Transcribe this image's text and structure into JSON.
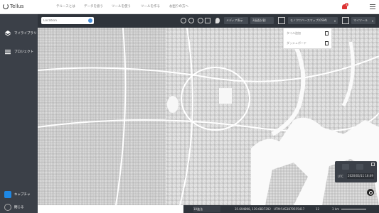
{
  "app": {
    "name": "Tellus"
  },
  "nav": [
    {
      "label": "テルースとは"
    },
    {
      "label": "データを扱う"
    },
    {
      "label": "ツールを使う"
    },
    {
      "label": "ツールを作る"
    },
    {
      "label": "お困りの方へ"
    }
  ],
  "notifications": {
    "count": "3"
  },
  "sidebar": {
    "items": [
      {
        "label": "マイライブラリ"
      },
      {
        "label": "プロジェクト"
      }
    ],
    "capture_label": "キャプチャ",
    "close_label": "閉じる"
  },
  "search": {
    "placeholder": "Location"
  },
  "toolbar": {
    "media_button": "メディア表示",
    "split_button": "2画面分割",
    "basemap_select": "モノクロベースマップ(OSM)",
    "mytool_button": "マイツール"
  },
  "layer_panel": {
    "rows": [
      {
        "label": "タイル追加"
      },
      {
        "label": "ダッシュボード"
      }
    ]
  },
  "time": {
    "utc_label": "UTC",
    "utc_value": "2020/03/11 16:49"
  },
  "status": {
    "coord_system": "10進法",
    "coords": "35.694898, 139.6837292",
    "utm": "UTM:54S3879555417",
    "zoom": "12",
    "scale": "3 km"
  },
  "colors": {
    "sidebar": "#3b4048",
    "toolbar": "#2f343b",
    "accent": "#1e88e5",
    "badge": "#d33333"
  },
  "icons": {
    "logo": "tellus-logo",
    "bell": "bell-icon",
    "layers": "layers-icon",
    "list": "list-icon",
    "camera": "camera-icon",
    "info": "info-icon"
  }
}
